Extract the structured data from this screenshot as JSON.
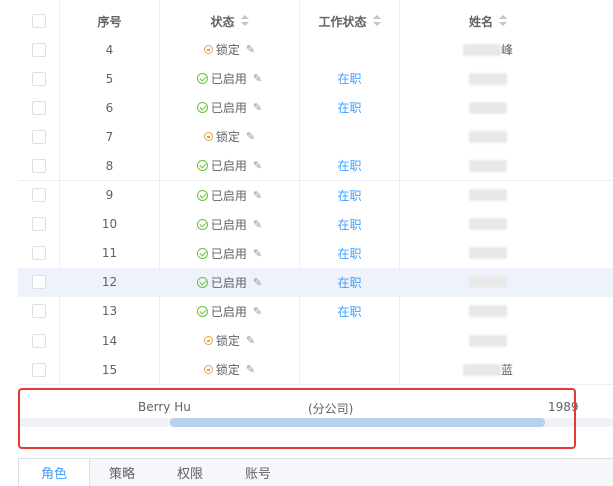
{
  "table": {
    "headers": {
      "seq": "序号",
      "status": "状态",
      "work_status": "工作状态",
      "name": "姓名"
    },
    "rows": [
      {
        "seq": "4",
        "status": "锁定",
        "work": "",
        "name": "峰",
        "icon": "lock",
        "hl": false
      },
      {
        "seq": "5",
        "status": "已启用",
        "work": "在职",
        "name": "",
        "icon": "check",
        "hl": false
      },
      {
        "seq": "6",
        "status": "已启用",
        "work": "在职",
        "name": "",
        "icon": "check",
        "hl": false
      },
      {
        "seq": "7",
        "status": "锁定",
        "work": "",
        "name": "",
        "icon": "lock",
        "hl": false
      },
      {
        "seq": "8",
        "status": "已启用",
        "work": "在职",
        "name": "",
        "icon": "check",
        "hl": false
      },
      {
        "seq": "9",
        "status": "已启用",
        "work": "在职",
        "name": "",
        "icon": "check",
        "hl": false
      },
      {
        "seq": "10",
        "status": "已启用",
        "work": "在职",
        "name": "",
        "icon": "check",
        "hl": false
      },
      {
        "seq": "11",
        "status": "已启用",
        "work": "在职",
        "name": "",
        "icon": "check",
        "hl": false
      },
      {
        "seq": "12",
        "status": "已启用",
        "work": "在职",
        "name": "",
        "icon": "check",
        "hl": true
      },
      {
        "seq": "13",
        "status": "已启用",
        "work": "在职",
        "name": "",
        "icon": "check",
        "hl": false
      },
      {
        "seq": "14",
        "status": "锁定",
        "work": "",
        "name": "",
        "icon": "lock",
        "hl": false
      },
      {
        "seq": "15",
        "status": "锁定",
        "work": "",
        "name": "蓝",
        "icon": "lock",
        "hl": false
      }
    ],
    "partial_row": {
      "name_en": "Berry Hu",
      "dept": "(分公司)",
      "year": "1989"
    }
  },
  "tabs": [
    "角色",
    "策略",
    "权限",
    "账号"
  ],
  "colors": {
    "accent": "#409eff",
    "highlight": "#eef3fb",
    "annotation": "#e53935"
  }
}
